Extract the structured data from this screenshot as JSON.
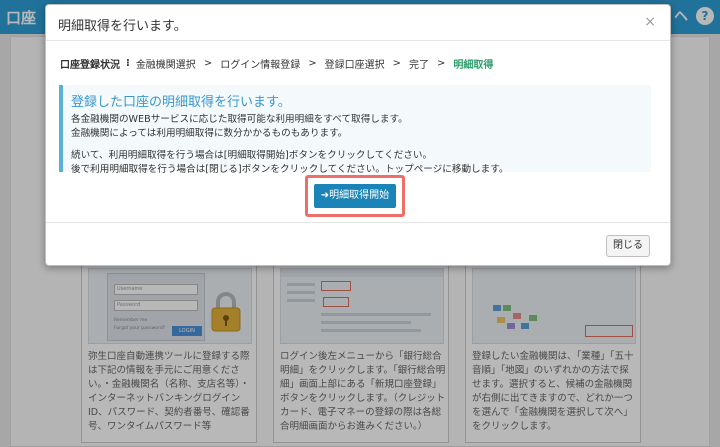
{
  "background": {
    "app_title": "口座",
    "header_icon_help": "?",
    "header_icon_user": "ヘ",
    "cards": [
      {
        "text": "弥生口座自動連携ツールに登録する際は下記の情報を手元にご用意ください。・金融機関名（名称、支店名等）・インターネットバンキングログインID、パスワード、契約者番号、確認番号、ワンタイムパスワード等",
        "login_user_placeholder": "Username",
        "login_pass_placeholder": "Password",
        "login_button": "LOGIN"
      },
      {
        "text": "ログイン後左メニューから「銀行総合明細」をクリックします。「銀行総合明細」画面上部にある「新規口座登録」ボタンをクリックします。（クレジットカード、電子マネーの登録の際は各総合明細画面からお進みください。）"
      },
      {
        "text": "登録したい金融機関は、「業種」「五十音順」「地図」のいずれかの方法で探せます。選択すると、候補の金融機関が右側に出てきますので、どれか一つを選んで「金融機関を選択して次へ」をクリックします。"
      }
    ]
  },
  "modal": {
    "title": "明細取得を行います。",
    "close_icon": "×",
    "steps": {
      "status_label": "口座登録状況",
      "separator": "⁝",
      "items": [
        "金融機関選択",
        "ログイン情報登録",
        "登録口座選択",
        "完了",
        "明細取得"
      ],
      "active_index": 4
    },
    "info": {
      "heading": "登録した口座の明細取得を行います。",
      "lines": [
        "各金融機関のWEBサービスに応じた取得可能な利用明細をすべて取得します。",
        "金融機関によっては利用明細取得に数分かかるものもあります。"
      ],
      "lines2": [
        "続いて、利用明細取得を行う場合は[明細取得開始]ボタンをクリックしてください。",
        "後で利用明細取得を行う場合は[閉じる]ボタンをクリックしてください。トップページに移動します。"
      ]
    },
    "primary_button": "➜明細取得開始",
    "close_button": "閉じる"
  },
  "colors": {
    "header_blue": "#2f9fd6",
    "primary_button": "#1a84b8",
    "highlight_border": "#ee6f6a",
    "active_step": "#2e9e6e",
    "info_accent": "#5bb0da"
  }
}
